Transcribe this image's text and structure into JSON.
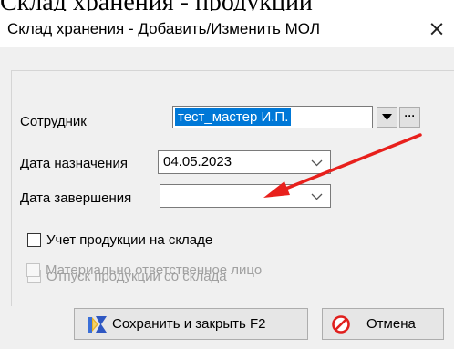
{
  "top_fragment": "Склад хранения - продукции",
  "window": {
    "title": "Склад хранения - Добавить/Изменить МОЛ",
    "close_glyph": "×"
  },
  "form": {
    "employee": {
      "label": "Сотрудник",
      "value": "тест_мастер И.П.",
      "dropdown_icon": "triangle-down-icon",
      "browse_label": "···"
    },
    "assign_date": {
      "label": "Дата назначения",
      "value": "04.05.2023"
    },
    "end_date": {
      "label": "Дата завершения",
      "value": ""
    },
    "checkboxes": [
      {
        "label": "Учет продукции на складе",
        "checked": false,
        "enabled": true
      },
      {
        "label": "Отпуск продукции со склада",
        "checked": false,
        "enabled": false
      },
      {
        "label": "Материально ответственное лицо",
        "checked": false,
        "enabled": false
      }
    ]
  },
  "buttons": {
    "save": {
      "label": "Сохранить и закрыть F2",
      "icon": "save-close-icon"
    },
    "cancel": {
      "label": "Отмена",
      "icon": "cancel-icon"
    }
  },
  "annotation": {
    "color": "#e8201c"
  }
}
